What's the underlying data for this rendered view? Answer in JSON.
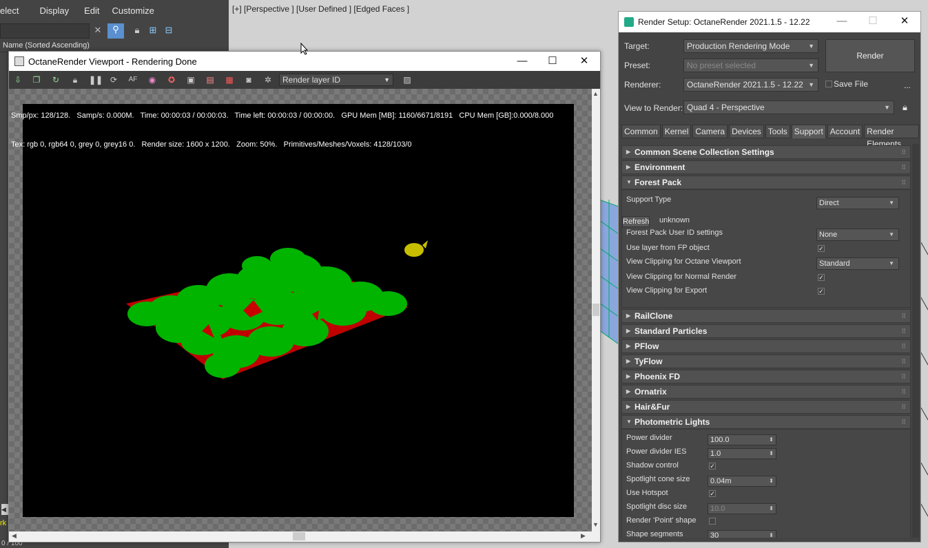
{
  "bg": {
    "menu": [
      "elect",
      "Display",
      "Edit",
      "Customize"
    ],
    "sort_header": "Name (Sorted Ascending)",
    "viewport_label": "[+] [Perspective ] [User Defined ] [Edged Faces ]",
    "status_left": "0 / 100",
    "status_side": "rk"
  },
  "octane": {
    "title": "OctaneRender Viewport - Rendering Done",
    "layer_select": "Render layer ID",
    "stats_line1": "Smp/px: 128/128.   Samp/s: 0.000M.   Time: 00:00:03 / 00:00:03.   Time left: 00:00:03 / 00:00:00.   GPU Mem [MB]: 1160/6671/8191   CPU Mem [GB]:0.000/8.000",
    "stats_line2": "Tex: rgb 0, rgb64 0, grey 0, grey16 0.   Render size: 1600 x 1200.   Zoom: 50%.   Primitives/Meshes/Voxels: 4128/103/0",
    "colors": {
      "green": "#00b400",
      "red": "#c80000",
      "yellow": "#c8be00"
    }
  },
  "rs": {
    "title": "Render Setup: OctaneRender 2021.1.5 - 12.22",
    "target_label": "Target:",
    "target_value": "Production Rendering Mode",
    "preset_label": "Preset:",
    "preset_value": "No preset selected",
    "renderer_label": "Renderer:",
    "renderer_value": "OctaneRender 2021.1.5 - 12.22",
    "save_file": "Save File",
    "more": "...",
    "view_label": "View to Render:",
    "view_value": "Quad 4 - Perspective",
    "render_btn": "Render",
    "tabs": [
      "Common",
      "Kernel",
      "Camera",
      "Devices",
      "Tools",
      "Support",
      "Account",
      "Render Elements"
    ],
    "rollouts": {
      "common_scene": "Common Scene Collection Settings",
      "environment": "Environment",
      "forest_pack": "Forest Pack",
      "railclone": "RailClone",
      "std_particles": "Standard Particles",
      "pflow": "PFlow",
      "tyflow": "TyFlow",
      "phoenix": "Phoenix FD",
      "ornatrix": "Ornatrix",
      "hairfur": "Hair&Fur",
      "photometric": "Photometric Lights"
    },
    "forest": {
      "support_type_label": "Support Type",
      "support_type_value": "Direct",
      "refresh": "Refresh",
      "unknown": "unknown",
      "user_id_label": "Forest Pack User ID settings",
      "user_id_value": "None",
      "use_layer_label": "Use layer from FP object",
      "clip_octane_label": "View Clipping for Octane Viewport",
      "clip_octane_value": "Standard",
      "clip_normal_label": "View Clipping for Normal Render",
      "clip_export_label": "View Clipping for Export"
    },
    "photometric": {
      "power_divider_label": "Power divider",
      "power_divider": "100.0",
      "power_ies_label": "Power divider IES",
      "power_ies": "1.0",
      "shadow_label": "Shadow control",
      "cone_label": "Spotlight cone size",
      "cone": "0.04m",
      "hotspot_label": "Use Hotspot",
      "disc_label": "Spotlight disc size",
      "disc": "10.0",
      "point_label": "Render 'Point' shape",
      "segments_label": "Shape segments",
      "segments": "30"
    }
  }
}
